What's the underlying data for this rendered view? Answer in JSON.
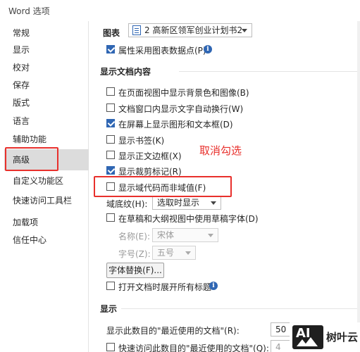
{
  "window": {
    "title": "Word 选项"
  },
  "sidebar": {
    "items": [
      {
        "label": "常规",
        "selected": false
      },
      {
        "label": "显示",
        "selected": false
      },
      {
        "label": "校对",
        "selected": false
      },
      {
        "label": "保存",
        "selected": false
      },
      {
        "label": "版式",
        "selected": false
      },
      {
        "label": "语言",
        "selected": false
      },
      {
        "label": "辅助功能",
        "selected": false
      },
      {
        "label": "高级",
        "selected": true
      },
      {
        "label": "自定义功能区",
        "selected": false
      },
      {
        "label": "快速访问工具栏",
        "selected": false
      },
      {
        "label": "加载项",
        "selected": false
      },
      {
        "label": "信任中心",
        "selected": false
      }
    ]
  },
  "chart_section": {
    "label": "图表",
    "doc_select": "2 高新区领军创业计划书2",
    "property_option": {
      "label": "属性采用图表数据点(P)",
      "checked": true
    }
  },
  "doc_content": {
    "title": "显示文档内容",
    "options": [
      {
        "label": "在页面视图中显示背景色和图像(B)",
        "checked": false
      },
      {
        "label": "文档窗口内显示文字自动换行(W)",
        "checked": false
      },
      {
        "label": "在屏幕上显示图形和文本框(D)",
        "checked": true
      },
      {
        "label": "显示书签(K)",
        "checked": false
      },
      {
        "label": "显示正文边框(X)",
        "checked": false
      },
      {
        "label": "显示裁剪标记(R)",
        "checked": true
      },
      {
        "label": "显示域代码而非域值(F)",
        "checked": false
      }
    ],
    "field_shading": {
      "label": "域底纹(H):",
      "value": "选取时显示"
    },
    "draft_font_option": {
      "label": "在草稿和大纲视图中使用草稿字体(D)",
      "checked": false
    },
    "font_name": {
      "label": "名称(E):",
      "value": "宋体"
    },
    "font_size": {
      "label": "字号(Z):",
      "value": "五号"
    },
    "font_substitution_button": "字体替换(F)...",
    "expand_headings_option": {
      "label": "打开文档时展开所有标题",
      "checked": false
    }
  },
  "display": {
    "title": "显示",
    "recent_docs": {
      "label": "显示此数目的\"最近使用的文档\"(R):",
      "value": "50"
    },
    "quick_access": {
      "label": "快速访问此数目的\"最近使用的文档\"(Q):",
      "value": "4",
      "checked": false
    }
  },
  "annotation": {
    "text": "取消勾选",
    "color": "#e8302c"
  },
  "watermark": {
    "text": "树叶云"
  },
  "colors": {
    "accent": "#2f66b3",
    "highlight": "#e8302c"
  }
}
